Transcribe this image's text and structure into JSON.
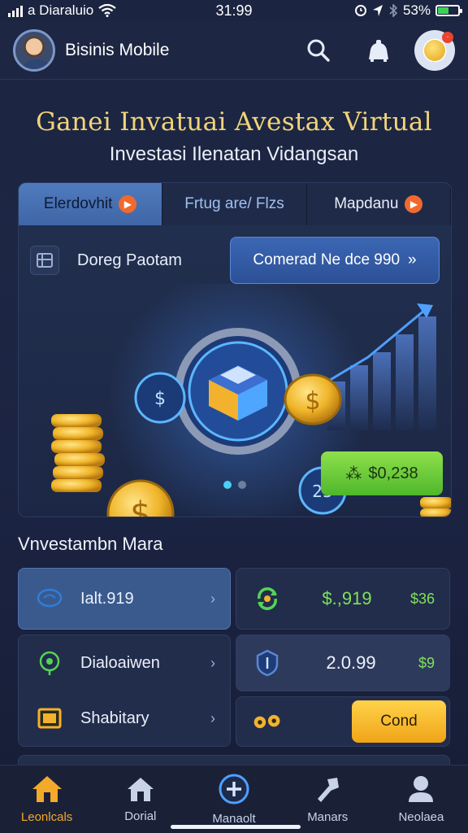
{
  "status_bar": {
    "carrier": "a Diaraluio",
    "time": "31:99",
    "battery_percent": "53%"
  },
  "header": {
    "app_name": "Bisinis Mobile",
    "icons": [
      "search-icon",
      "bell-icon"
    ]
  },
  "hero": {
    "title": "Ganei Invatuai Avestax Virtual",
    "subtitle": "Investasi Ilenatan Vidangsan"
  },
  "tabs": [
    {
      "label": "Elerdovhit",
      "active": true
    },
    {
      "label": "Frtug are/ Flzs",
      "active": false
    },
    {
      "label": "Mapdanu",
      "active": false
    }
  ],
  "card": {
    "label": "Doreg Paotam",
    "cta_label": "Comerad Ne dce 990",
    "cta_arrow": "»",
    "price": "$0,238",
    "price_prefix": "⁂",
    "badge_coin_2": "25"
  },
  "invest_section": {
    "title": "Vnvestambn Mara",
    "left_items": [
      {
        "label": "Ialt.919",
        "icon": "chat-icon"
      },
      {
        "label": "Dialoaiwen",
        "icon": "target-icon"
      },
      {
        "label": "Shabitary",
        "icon": "wallet-icon"
      }
    ],
    "right_items": [
      {
        "value": "$.,919",
        "secondary": "$36",
        "icon": "refresh-icon"
      },
      {
        "value": "2.0.99",
        "secondary": "$9",
        "icon": "shield-icon"
      },
      {
        "button_label": "Cond",
        "icon": "gears-icon"
      }
    ]
  },
  "bottom_nav": [
    {
      "label": "Leonlcals",
      "icon": "home-icon",
      "active": true
    },
    {
      "label": "Dorial",
      "icon": "house-icon",
      "active": false
    },
    {
      "label": "Manaolt",
      "icon": "plus-circle-icon",
      "active": false
    },
    {
      "label": "Manars",
      "icon": "tool-icon",
      "active": false
    },
    {
      "label": "Neolaea",
      "icon": "person-icon",
      "active": false
    }
  ],
  "colors": {
    "accent": "#f2d37a",
    "primary": "#3b67b4",
    "positive": "#7fe25a",
    "warn": "#f0a418"
  }
}
